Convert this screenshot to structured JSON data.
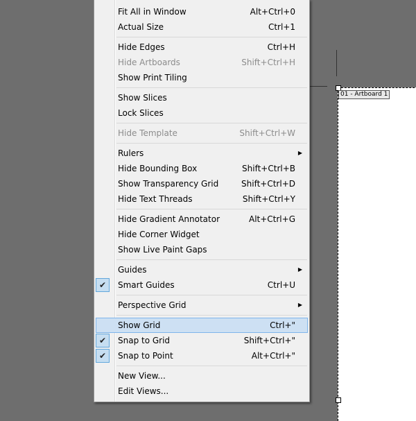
{
  "artboard": {
    "label": "01 - Artboard 1"
  },
  "menu": {
    "groups": [
      [
        {
          "label": "Fit All in Window",
          "shortcut": "Alt+Ctrl+0"
        },
        {
          "label": "Actual Size",
          "shortcut": "Ctrl+1"
        }
      ],
      [
        {
          "label": "Hide Edges",
          "shortcut": "Ctrl+H"
        },
        {
          "label": "Hide Artboards",
          "shortcut": "Shift+Ctrl+H",
          "disabled": true
        },
        {
          "label": "Show Print Tiling",
          "shortcut": ""
        }
      ],
      [
        {
          "label": "Show Slices",
          "shortcut": ""
        },
        {
          "label": "Lock Slices",
          "shortcut": ""
        }
      ],
      [
        {
          "label": "Hide Template",
          "shortcut": "Shift+Ctrl+W",
          "disabled": true
        }
      ],
      [
        {
          "label": "Rulers",
          "shortcut": "",
          "submenu": true
        },
        {
          "label": "Hide Bounding Box",
          "shortcut": "Shift+Ctrl+B"
        },
        {
          "label": "Show Transparency Grid",
          "shortcut": "Shift+Ctrl+D"
        },
        {
          "label": "Hide Text Threads",
          "shortcut": "Shift+Ctrl+Y"
        }
      ],
      [
        {
          "label": "Hide Gradient Annotator",
          "shortcut": "Alt+Ctrl+G"
        },
        {
          "label": "Hide Corner Widget",
          "shortcut": ""
        },
        {
          "label": "Show Live Paint Gaps",
          "shortcut": ""
        }
      ],
      [
        {
          "label": "Guides",
          "shortcut": "",
          "submenu": true
        },
        {
          "label": "Smart Guides",
          "shortcut": "Ctrl+U",
          "checked": true
        }
      ],
      [
        {
          "label": "Perspective Grid",
          "shortcut": "",
          "submenu": true
        }
      ],
      [
        {
          "label": "Show Grid",
          "shortcut": "Ctrl+\"",
          "highlighted": true
        },
        {
          "label": "Snap to Grid",
          "shortcut": "Shift+Ctrl+\"",
          "checked": true
        },
        {
          "label": "Snap to Point",
          "shortcut": "Alt+Ctrl+\"",
          "checked": true
        }
      ],
      [
        {
          "label": "New View...",
          "shortcut": ""
        },
        {
          "label": "Edit Views...",
          "shortcut": ""
        }
      ]
    ]
  }
}
